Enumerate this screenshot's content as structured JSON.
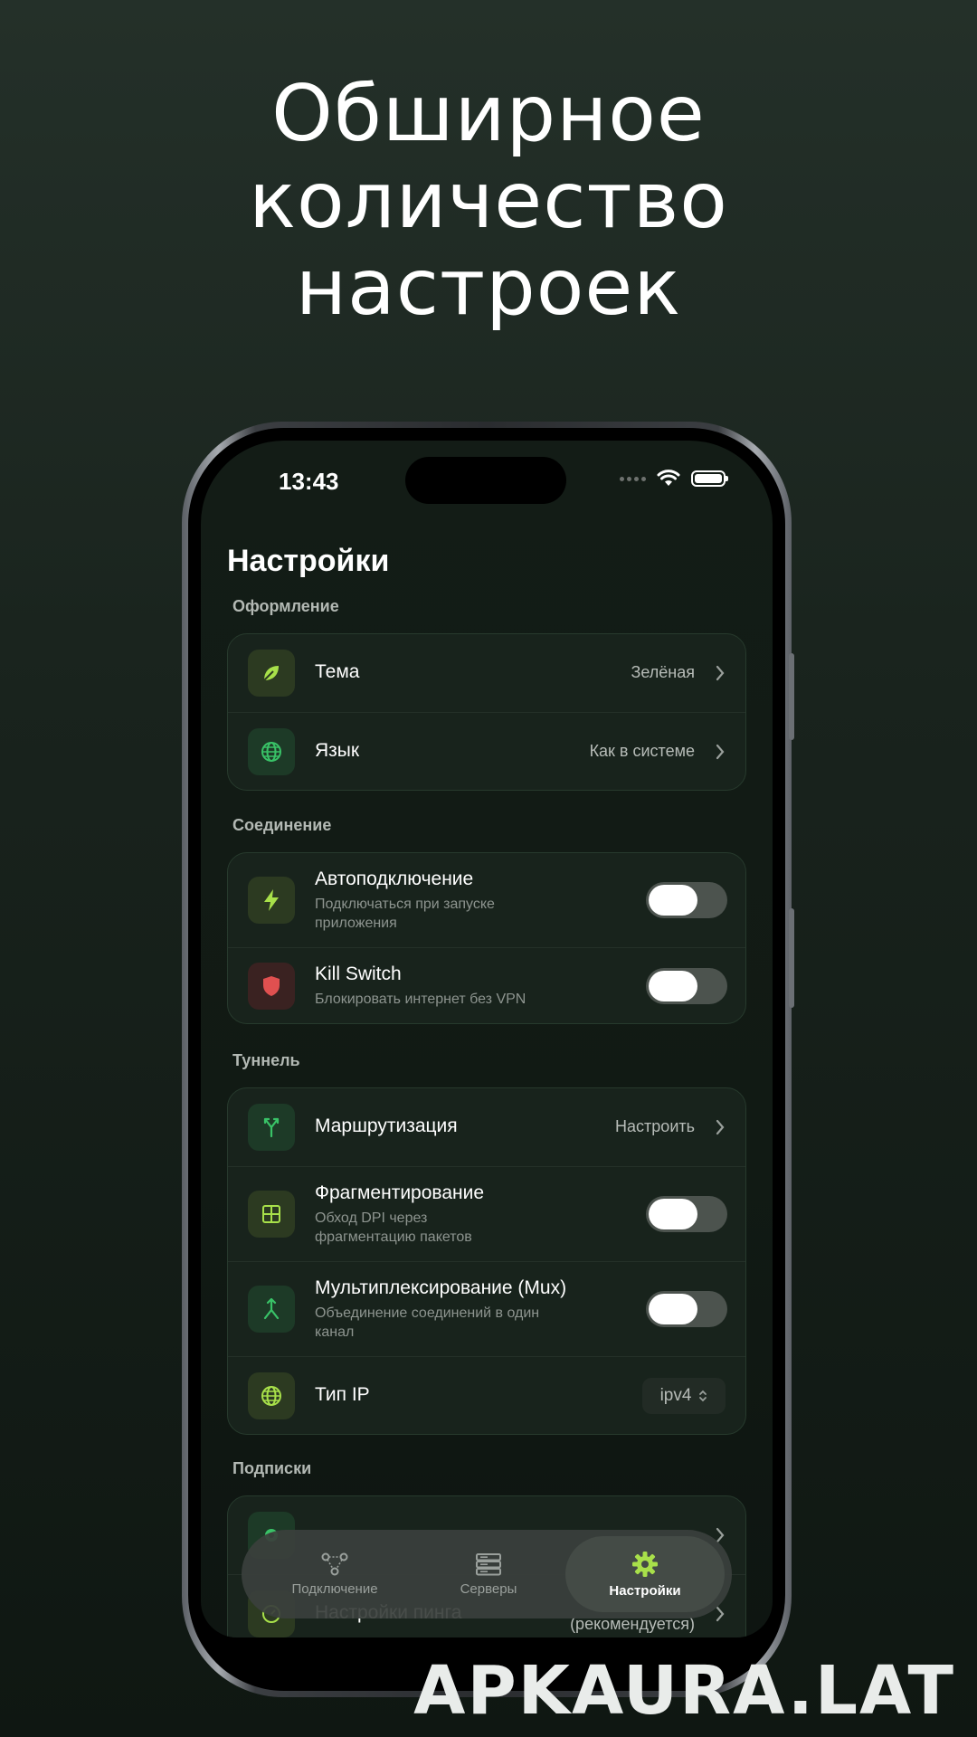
{
  "headline": [
    "Обширное",
    "количество",
    "настроек"
  ],
  "status": {
    "time": "13:43"
  },
  "page": {
    "title": "Настройки"
  },
  "sections": {
    "appearance": "Оформление",
    "connection": "Соединение",
    "tunnel": "Туннель",
    "subscriptions": "Подписки"
  },
  "appearance": {
    "theme": {
      "title": "Тема",
      "value": "Зелёная"
    },
    "language": {
      "title": "Язык",
      "value": "Как в системе"
    }
  },
  "connection": {
    "autoconnect": {
      "title": "Автоподключение",
      "subtitle": "Подключаться при запуске приложения",
      "enabled": false
    },
    "killswitch": {
      "title": "Kill Switch",
      "subtitle": "Блокировать интернет без VPN",
      "enabled": false
    }
  },
  "tunnel": {
    "routing": {
      "title": "Маршрутизация",
      "value": "Настроить"
    },
    "fragmentation": {
      "title": "Фрагментирование",
      "subtitle": "Обход DPI через фрагментацию пакетов",
      "enabled": false
    },
    "mux": {
      "title": "Мультиплексирование (Mux)",
      "subtitle": "Объединение соединений в один канал",
      "enabled": false
    },
    "iptype": {
      "title": "Тип IP",
      "value": "ipv4"
    }
  },
  "subscriptions": {
    "ping": {
      "title": "Настройки пинга",
      "value": "(рекомендуется)"
    }
  },
  "tabs": [
    {
      "label": "Подключение",
      "icon": "connection-icon"
    },
    {
      "label": "Серверы",
      "icon": "servers-icon"
    },
    {
      "label": "Настройки",
      "icon": "gear-icon",
      "active": true
    }
  ],
  "watermark": "APKAURA.LAT",
  "colors": {
    "accent": "#a8e04a",
    "danger": "#e05050",
    "green": "#39c267"
  }
}
